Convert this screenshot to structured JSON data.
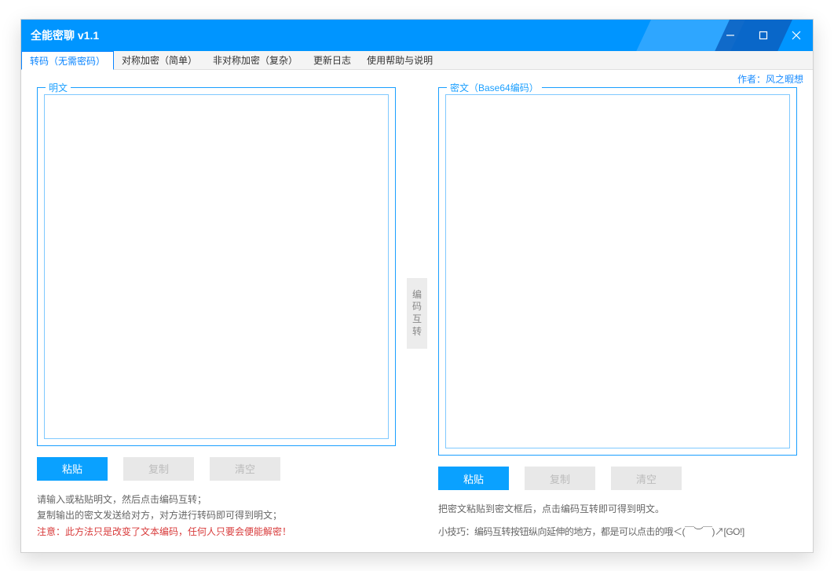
{
  "window": {
    "title": "全能密聊 v1.1"
  },
  "tabs": [
    {
      "label": "转码（无需密码）",
      "active": true
    },
    {
      "label": "对称加密（简单）",
      "active": false
    },
    {
      "label": "非对称加密（复杂）",
      "active": false
    },
    {
      "label": "更新日志",
      "active": false
    },
    {
      "label": "使用帮助与说明",
      "active": false
    }
  ],
  "author": {
    "label": "作者：风之暇想"
  },
  "left": {
    "legend": "明文",
    "value": "",
    "buttons": {
      "paste": "粘贴",
      "copy": "复制",
      "clear": "清空"
    },
    "hints": {
      "line1": "请输入或粘贴明文，然后点击编码互转；",
      "line2": "复制输出的密文发送给对方，对方进行转码即可得到明文；",
      "line3": "注意：此方法只是改变了文本编码，任何人只要会便能解密！"
    }
  },
  "swap": {
    "label": "编码互转"
  },
  "right": {
    "legend": "密文（Base64编码）",
    "value": "",
    "buttons": {
      "paste": "粘贴",
      "copy": "复制",
      "clear": "清空"
    },
    "hints": {
      "line1": "把密文粘贴到密文框后，点击编码互转即可得到明文。",
      "line2": "小技巧：编码互转按钮纵向延伸的地方，都是可以点击的哦＜(￣︶￣)↗[GO!]"
    }
  }
}
